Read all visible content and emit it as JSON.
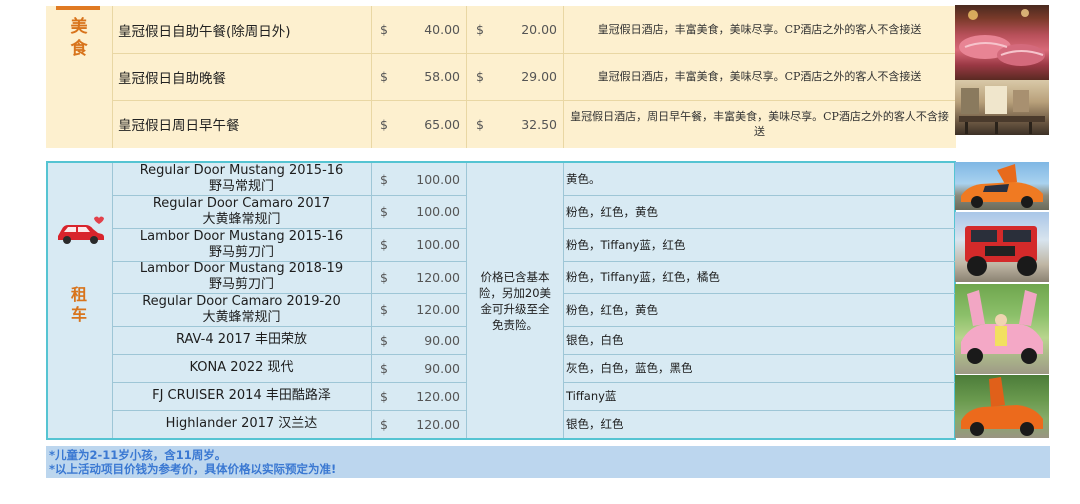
{
  "food": {
    "side_chars": [
      "美",
      "食"
    ],
    "rows": [
      {
        "name": "皇冠假日自助午餐(除周日外)",
        "currency": "$",
        "adult": "40.00",
        "child_currency": "$",
        "child": "20.00",
        "desc": "皇冠假日酒店，丰富美食，美味尽享。CP酒店之外的客人不含接送"
      },
      {
        "name": "皇冠假日自助晚餐",
        "currency": "$",
        "adult": "58.00",
        "child_currency": "$",
        "child": "29.00",
        "desc": "皇冠假日酒店，丰富美食，美味尽享。CP酒店之外的客人不含接送"
      },
      {
        "name": "皇冠假日周日早午餐",
        "currency": "$",
        "adult": "65.00",
        "child_currency": "$",
        "child": "32.50",
        "desc": "皇冠假日酒店，周日早午餐，丰富美食，美味尽享。CP酒店之外的客人不含接送"
      }
    ]
  },
  "cars": {
    "side_chars": [
      "租",
      "车"
    ],
    "note": "价格已含基本险，另加20美金可升级至全免责险。",
    "rows": [
      {
        "name_line1": "Regular Door Mustang  2015-16",
        "name_line2": "野马常规门",
        "currency": "$",
        "price": "100.00",
        "colors": "黄色。"
      },
      {
        "name_line1": "Regular Door Camaro  2017",
        "name_line2": "大黄蜂常规门",
        "currency": "$",
        "price": "100.00",
        "colors": "粉色，红色，黄色"
      },
      {
        "name_line1": "Lambor Door Mustang  2015-16",
        "name_line2": "野马剪刀门",
        "currency": "$",
        "price": "100.00",
        "colors": "粉色，Tiffany蓝，红色"
      },
      {
        "name_line1": "Lambor Door Mustang  2018-19",
        "name_line2": "野马剪刀门",
        "currency": "$",
        "price": "120.00",
        "colors": "粉色，Tiffany蓝，红色，橘色"
      },
      {
        "name_line1": "Regular Door  Camaro  2019-20",
        "name_line2": "大黄蜂常规门",
        "currency": "$",
        "price": "120.00",
        "colors": "粉色，红色，黄色"
      },
      {
        "name_line1": "RAV-4  2017 丰田荣放",
        "name_line2": "",
        "currency": "$",
        "price": "90.00",
        "colors": "银色，白色"
      },
      {
        "name_line1": "KONA 2022 现代",
        "name_line2": "",
        "currency": "$",
        "price": "90.00",
        "colors": "灰色，白色，蓝色，黑色"
      },
      {
        "name_line1": "FJ CRUISER  2014 丰田酷路泽",
        "name_line2": "",
        "currency": "$",
        "price": "120.00",
        "colors": "Tiffany蓝"
      },
      {
        "name_line1": "Highlander 2017 汉兰达",
        "name_line2": "",
        "currency": "$",
        "price": "120.00",
        "colors": "银色，红色"
      }
    ]
  },
  "notes": [
    "*儿童为2-11岁小孩，含11周岁。",
    "*以上活动项目价钱为参考价，具体价格以实际预定为准!"
  ],
  "colors": {
    "food_bg": "#fdf0cf",
    "car_bg": "#d8eaf3",
    "car_border": "#55c4d2",
    "accent_orange": "#d8741c",
    "note_blue": "#3a78d2"
  }
}
